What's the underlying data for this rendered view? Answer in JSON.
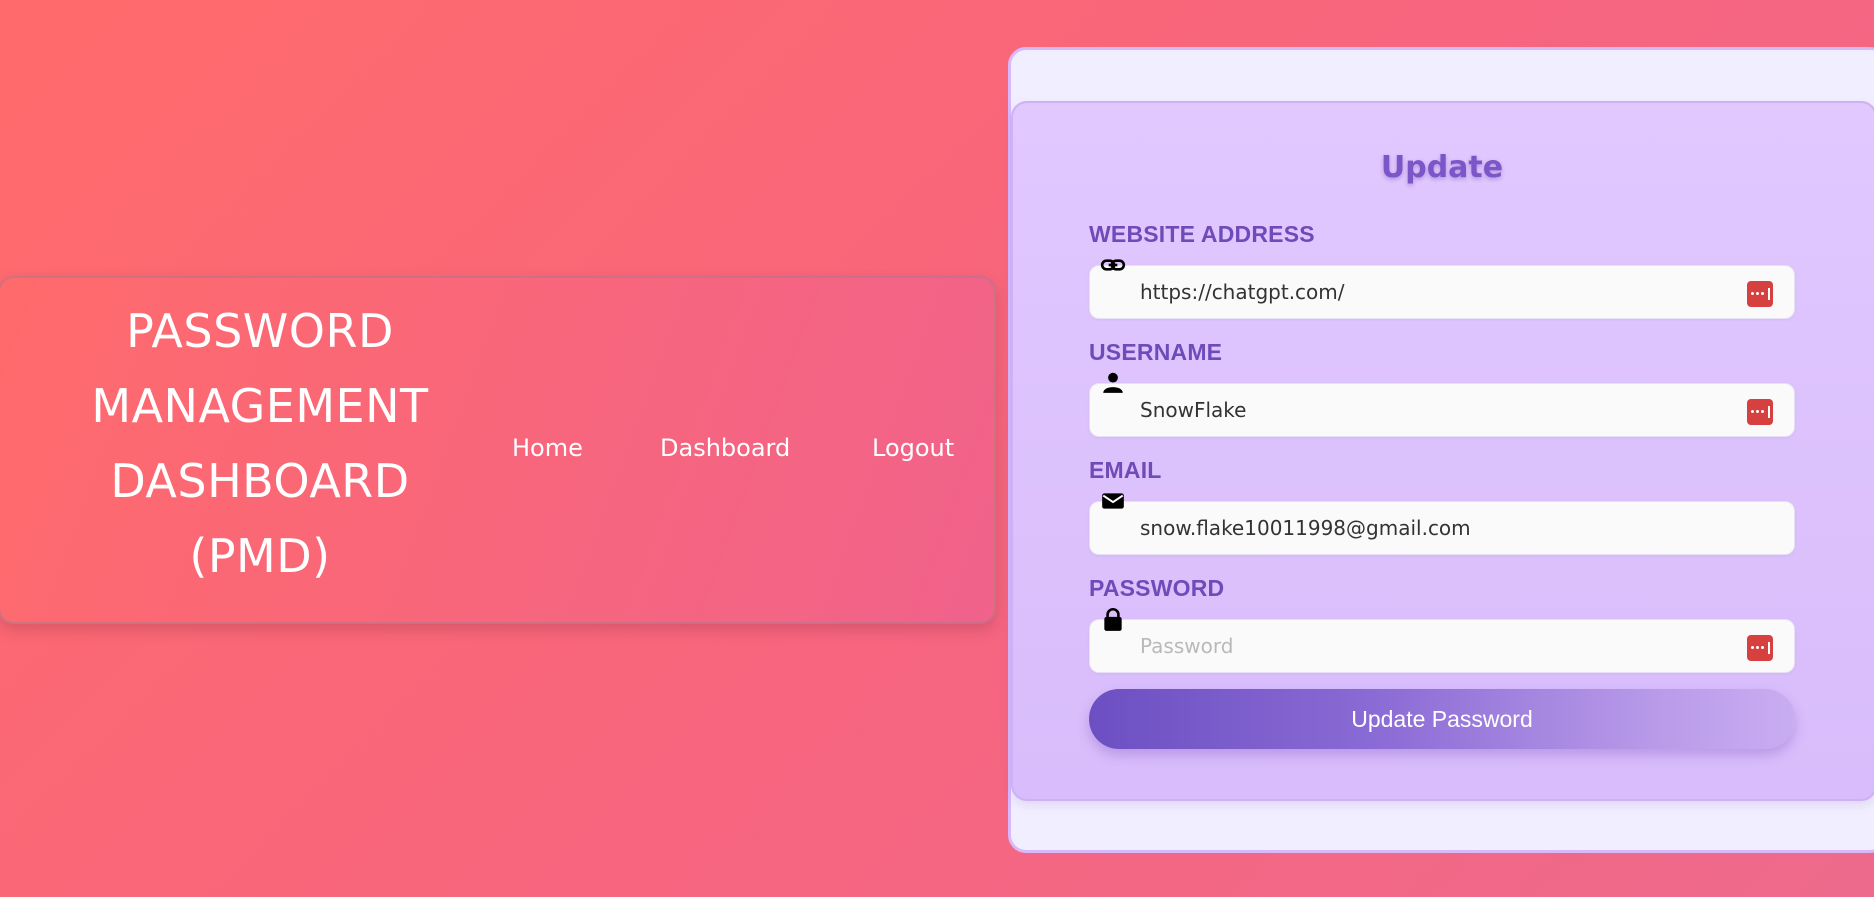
{
  "header": {
    "brand_lines": [
      "PASSWORD",
      "MANAGEMENT",
      "DASHBOARD",
      "(PMD)"
    ],
    "nav": {
      "home": "Home",
      "dashboard": "Dashboard",
      "logout": "Logout"
    }
  },
  "form": {
    "title": "Update",
    "fields": [
      {
        "label": "WEBSITE ADDRESS",
        "icon": "link-icon",
        "value": "https://chatgpt.com/",
        "placeholder": "",
        "has_password_manager_badge": true
      },
      {
        "label": "USERNAME",
        "icon": "user-icon",
        "value": "SnowFlake",
        "placeholder": "",
        "has_password_manager_badge": true
      },
      {
        "label": "EMAIL",
        "icon": "envelope-icon",
        "value": "snow.flake10011998@gmail.com",
        "placeholder": "",
        "has_password_manager_badge": false
      },
      {
        "label": "PASSWORD",
        "icon": "lock-icon",
        "value": "",
        "placeholder": "Password",
        "has_password_manager_badge": true
      }
    ],
    "submit_label": "Update Password"
  },
  "colors": {
    "background": "#f7657f",
    "accent": "#7b56c8",
    "badge": "#d6403f"
  }
}
